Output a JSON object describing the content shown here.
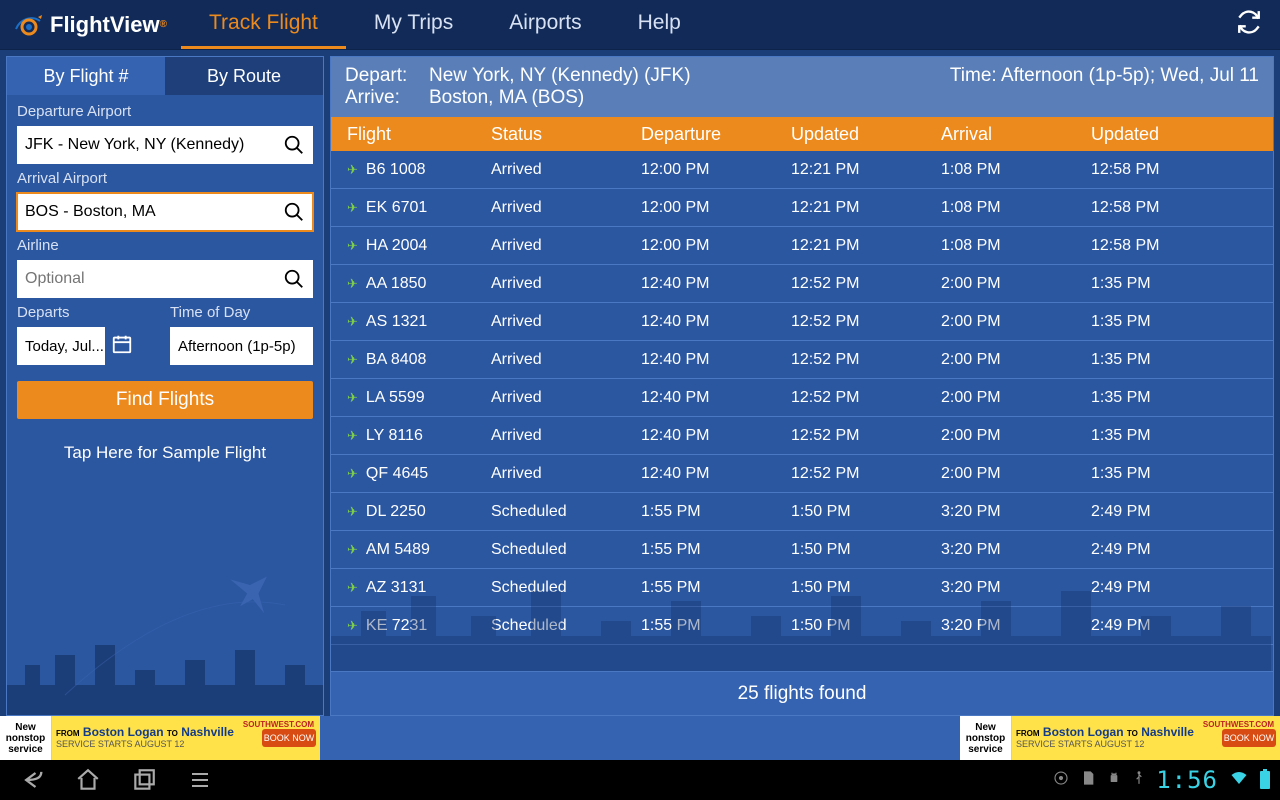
{
  "brand": {
    "name": "FlightView",
    "reg": "®"
  },
  "nav": {
    "tabs": [
      "Track Flight",
      "My Trips",
      "Airports",
      "Help"
    ],
    "active": 0
  },
  "sidebar": {
    "subtabs": {
      "byflight": "By Flight #",
      "byroute": "By Route",
      "active": 1
    },
    "labels": {
      "dep": "Departure Airport",
      "arr": "Arrival Airport",
      "airline": "Airline",
      "departs": "Departs",
      "tod": "Time of Day"
    },
    "values": {
      "dep": "JFK - New York, NY (Kennedy)",
      "arr": "BOS - Boston, MA",
      "airline_placeholder": "Optional",
      "date": "Today, Jul...",
      "tod": "Afternoon (1p-5p)"
    },
    "button": "Find Flights",
    "sample": "Tap Here for Sample Flight"
  },
  "results": {
    "header": {
      "depart_k": "Depart:",
      "depart_v": "New York, NY (Kennedy) (JFK)",
      "arrive_k": "Arrive:",
      "arrive_v": "Boston, MA (BOS)",
      "time_k": "Time:",
      "time_v": "Afternoon (1p-5p); Wed, Jul 11"
    },
    "columns": [
      "Flight",
      "Status",
      "Departure",
      "Updated",
      "Arrival",
      "Updated"
    ],
    "rows": [
      {
        "flight": "B6 1008",
        "status": "Arrived",
        "dep": "12:00 PM",
        "upd1": "12:21 PM",
        "arr": "1:08 PM",
        "upd2": "12:58 PM"
      },
      {
        "flight": "EK 6701",
        "status": "Arrived",
        "dep": "12:00 PM",
        "upd1": "12:21 PM",
        "arr": "1:08 PM",
        "upd2": "12:58 PM"
      },
      {
        "flight": "HA 2004",
        "status": "Arrived",
        "dep": "12:00 PM",
        "upd1": "12:21 PM",
        "arr": "1:08 PM",
        "upd2": "12:58 PM"
      },
      {
        "flight": "AA 1850",
        "status": "Arrived",
        "dep": "12:40 PM",
        "upd1": "12:52 PM",
        "arr": "2:00 PM",
        "upd2": "1:35 PM"
      },
      {
        "flight": "AS 1321",
        "status": "Arrived",
        "dep": "12:40 PM",
        "upd1": "12:52 PM",
        "arr": "2:00 PM",
        "upd2": "1:35 PM"
      },
      {
        "flight": "BA 8408",
        "status": "Arrived",
        "dep": "12:40 PM",
        "upd1": "12:52 PM",
        "arr": "2:00 PM",
        "upd2": "1:35 PM"
      },
      {
        "flight": "LA 5599",
        "status": "Arrived",
        "dep": "12:40 PM",
        "upd1": "12:52 PM",
        "arr": "2:00 PM",
        "upd2": "1:35 PM"
      },
      {
        "flight": "LY 8116",
        "status": "Arrived",
        "dep": "12:40 PM",
        "upd1": "12:52 PM",
        "arr": "2:00 PM",
        "upd2": "1:35 PM"
      },
      {
        "flight": "QF 4645",
        "status": "Arrived",
        "dep": "12:40 PM",
        "upd1": "12:52 PM",
        "arr": "2:00 PM",
        "upd2": "1:35 PM"
      },
      {
        "flight": "DL 2250",
        "status": "Scheduled",
        "dep": "1:55 PM",
        "upd1": "1:50 PM",
        "arr": "3:20 PM",
        "upd2": "2:49 PM"
      },
      {
        "flight": "AM 5489",
        "status": "Scheduled",
        "dep": "1:55 PM",
        "upd1": "1:50 PM",
        "arr": "3:20 PM",
        "upd2": "2:49 PM"
      },
      {
        "flight": "AZ 3131",
        "status": "Scheduled",
        "dep": "1:55 PM",
        "upd1": "1:50 PM",
        "arr": "3:20 PM",
        "upd2": "2:49 PM"
      },
      {
        "flight": "KE 7231",
        "status": "Scheduled",
        "dep": "1:55 PM",
        "upd1": "1:50 PM",
        "arr": "3:20 PM",
        "upd2": "2:49 PM"
      }
    ],
    "footer": "25 flights found"
  },
  "ad": {
    "newnonstop": "New nonstop service",
    "from": "FROM",
    "from_city": "Boston Logan",
    "to": "TO",
    "to_city": "Nashville",
    "sub": "SERVICE STARTS AUGUST 12",
    "brand": "SOUTHWEST.COM",
    "cta": "BOOK NOW"
  },
  "android": {
    "clock": "1:56"
  }
}
